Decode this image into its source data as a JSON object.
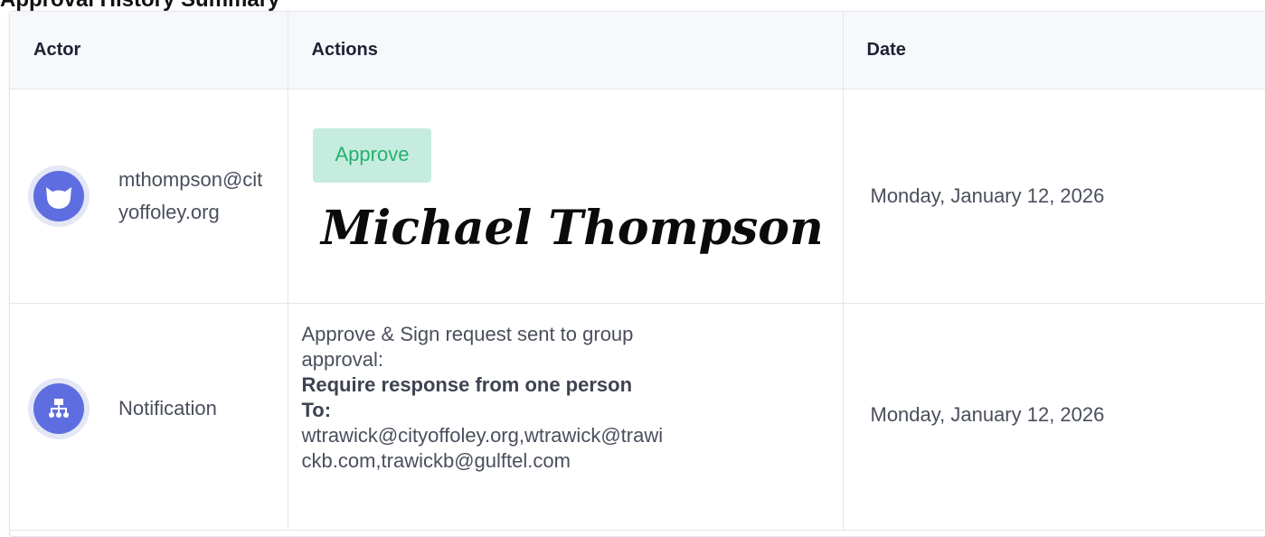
{
  "section_title": "Approval History Summary",
  "table": {
    "headers": [
      "Actor",
      "Actions",
      "Date"
    ],
    "rows": [
      {
        "actor": "mthompson@cityoffoley.org",
        "actor_icon": "fox-avatar-icon",
        "action_badge": "Approve",
        "signature": "Michael Thompson",
        "date": "Monday, January 12, 2026"
      },
      {
        "actor": "Notification",
        "actor_icon": "org-chart-icon",
        "action_line1": "Approve & Sign request sent to group approval:",
        "action_bold": "Require response from one person",
        "action_to_label": "To:",
        "action_recipients": "wtrawick@cityoffoley.org,wtrawick@trawickb.com,trawickb@gulftel.com",
        "date": "Monday, January 12, 2026"
      }
    ]
  },
  "colors": {
    "accent": "#5e6ee0",
    "approve_bg": "#c6ecdf",
    "approve_text": "#25b06e"
  }
}
